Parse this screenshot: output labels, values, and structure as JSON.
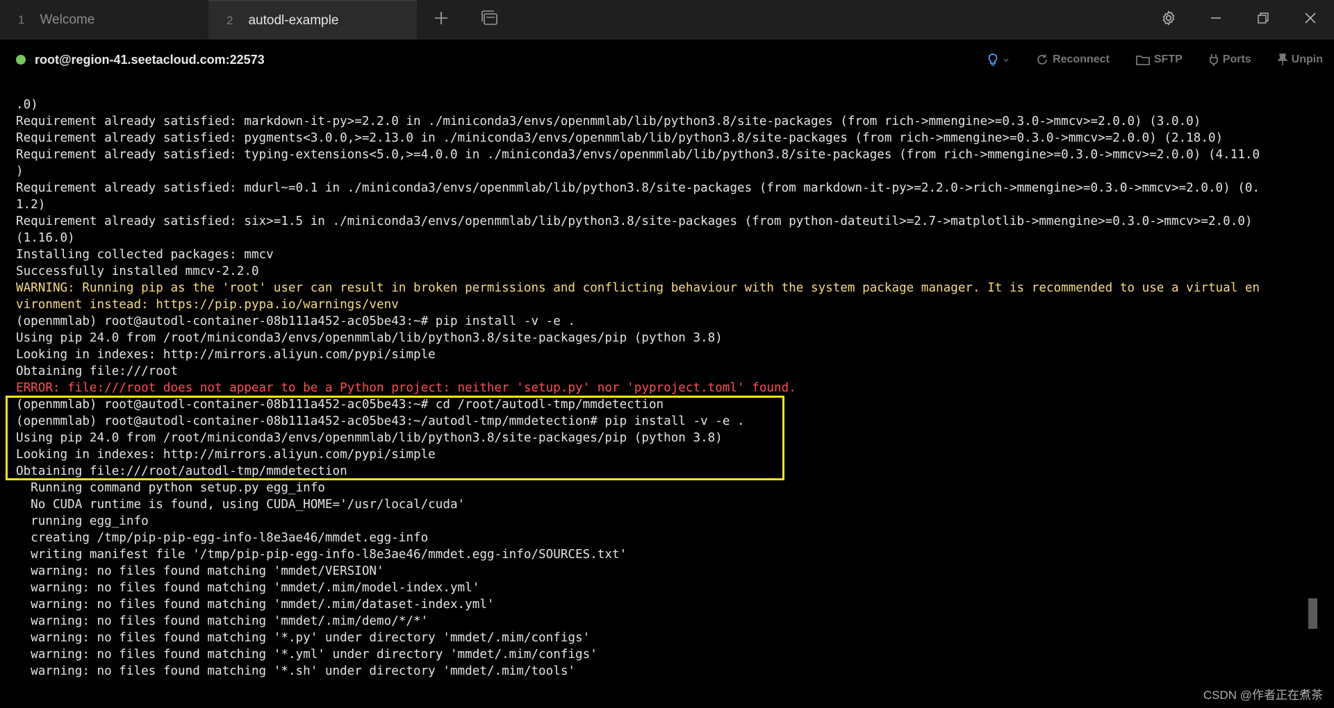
{
  "tabs": [
    {
      "num": "1",
      "label": "Welcome"
    },
    {
      "num": "2",
      "label": "autodl-example"
    }
  ],
  "icons": {
    "new_tab": "plus-icon",
    "tab_overview": "window-stack-icon",
    "settings": "gear-icon",
    "minimize": "minimize-icon",
    "restore": "restore-icon",
    "close": "close-icon",
    "hint": "lightbulb-icon"
  },
  "status": {
    "host": "root@region-41.seetacloud.com:22573",
    "connected_color": "#7cc75a"
  },
  "actions": {
    "reconnect": "Reconnect",
    "sftp": "SFTP",
    "ports": "Ports",
    "unpin": "Unpin"
  },
  "terminal": {
    "lines": [
      {
        "text": ".0)",
        "kind": "normal"
      },
      {
        "text": "Requirement already satisfied: markdown-it-py>=2.2.0 in ./miniconda3/envs/openmmlab/lib/python3.8/site-packages (from rich->mmengine>=0.3.0->mmcv>=2.0.0) (3.0.0)",
        "kind": "normal"
      },
      {
        "text": "Requirement already satisfied: pygments<3.0.0,>=2.13.0 in ./miniconda3/envs/openmmlab/lib/python3.8/site-packages (from rich->mmengine>=0.3.0->mmcv>=2.0.0) (2.18.0)",
        "kind": "normal"
      },
      {
        "text": "Requirement already satisfied: typing-extensions<5.0,>=4.0.0 in ./miniconda3/envs/openmmlab/lib/python3.8/site-packages (from rich->mmengine>=0.3.0->mmcv>=2.0.0) (4.11.0",
        "kind": "normal"
      },
      {
        "text": ")",
        "kind": "normal"
      },
      {
        "text": "Requirement already satisfied: mdurl~=0.1 in ./miniconda3/envs/openmmlab/lib/python3.8/site-packages (from markdown-it-py>=2.2.0->rich->mmengine>=0.3.0->mmcv>=2.0.0) (0.",
        "kind": "normal"
      },
      {
        "text": "1.2)",
        "kind": "normal"
      },
      {
        "text": "Requirement already satisfied: six>=1.5 in ./miniconda3/envs/openmmlab/lib/python3.8/site-packages (from python-dateutil>=2.7->matplotlib->mmengine>=0.3.0->mmcv>=2.0.0)",
        "kind": "normal"
      },
      {
        "text": "(1.16.0)",
        "kind": "normal"
      },
      {
        "text": "Installing collected packages: mmcv",
        "kind": "normal"
      },
      {
        "text": "Successfully installed mmcv-2.2.0",
        "kind": "normal"
      },
      {
        "text": "WARNING: Running pip as the 'root' user can result in broken permissions and conflicting behaviour with the system package manager. It is recommended to use a virtual en",
        "kind": "warn"
      },
      {
        "text": "vironment instead: https://pip.pypa.io/warnings/venv",
        "kind": "warn"
      },
      {
        "text": "(openmmlab) root@autodl-container-08b111a452-ac05be43:~# pip install -v -e .",
        "kind": "normal"
      },
      {
        "text": "Using pip 24.0 from /root/miniconda3/envs/openmmlab/lib/python3.8/site-packages/pip (python 3.8)",
        "kind": "normal"
      },
      {
        "text": "Looking in indexes: http://mirrors.aliyun.com/pypi/simple",
        "kind": "normal"
      },
      {
        "text": "Obtaining file:///root",
        "kind": "normal"
      },
      {
        "text": "ERROR: file:///root does not appear to be a Python project: neither 'setup.py' nor 'pyproject.toml' found.",
        "kind": "err"
      },
      {
        "text": "(openmmlab) root@autodl-container-08b111a452-ac05be43:~# cd /root/autodl-tmp/mmdetection",
        "kind": "normal"
      },
      {
        "text": "(openmmlab) root@autodl-container-08b111a452-ac05be43:~/autodl-tmp/mmdetection# pip install -v -e .",
        "kind": "normal"
      },
      {
        "text": "Using pip 24.0 from /root/miniconda3/envs/openmmlab/lib/python3.8/site-packages/pip (python 3.8)",
        "kind": "normal"
      },
      {
        "text": "Looking in indexes: http://mirrors.aliyun.com/pypi/simple",
        "kind": "normal"
      },
      {
        "text": "Obtaining file:///root/autodl-tmp/mmdetection",
        "kind": "normal"
      },
      {
        "text": "  Running command python setup.py egg_info",
        "kind": "normal"
      },
      {
        "text": "  No CUDA runtime is found, using CUDA_HOME='/usr/local/cuda'",
        "kind": "normal"
      },
      {
        "text": "  running egg_info",
        "kind": "normal"
      },
      {
        "text": "  creating /tmp/pip-pip-egg-info-l8e3ae46/mmdet.egg-info",
        "kind": "normal"
      },
      {
        "text": "  writing manifest file '/tmp/pip-pip-egg-info-l8e3ae46/mmdet.egg-info/SOURCES.txt'",
        "kind": "normal"
      },
      {
        "text": "  warning: no files found matching 'mmdet/VERSION'",
        "kind": "normal"
      },
      {
        "text": "  warning: no files found matching 'mmdet/.mim/model-index.yml'",
        "kind": "normal"
      },
      {
        "text": "  warning: no files found matching 'mmdet/.mim/dataset-index.yml'",
        "kind": "normal"
      },
      {
        "text": "  warning: no files found matching 'mmdet/.mim/demo/*/*'",
        "kind": "normal"
      },
      {
        "text": "  warning: no files found matching '*.py' under directory 'mmdet/.mim/configs'",
        "kind": "normal"
      },
      {
        "text": "  warning: no files found matching '*.yml' under directory 'mmdet/.mim/configs'",
        "kind": "normal"
      },
      {
        "text": "  warning: no files found matching '*.sh' under directory 'mmdet/.mim/tools'",
        "kind": "normal"
      }
    ]
  },
  "watermark": "CSDN @作者正在煮茶"
}
